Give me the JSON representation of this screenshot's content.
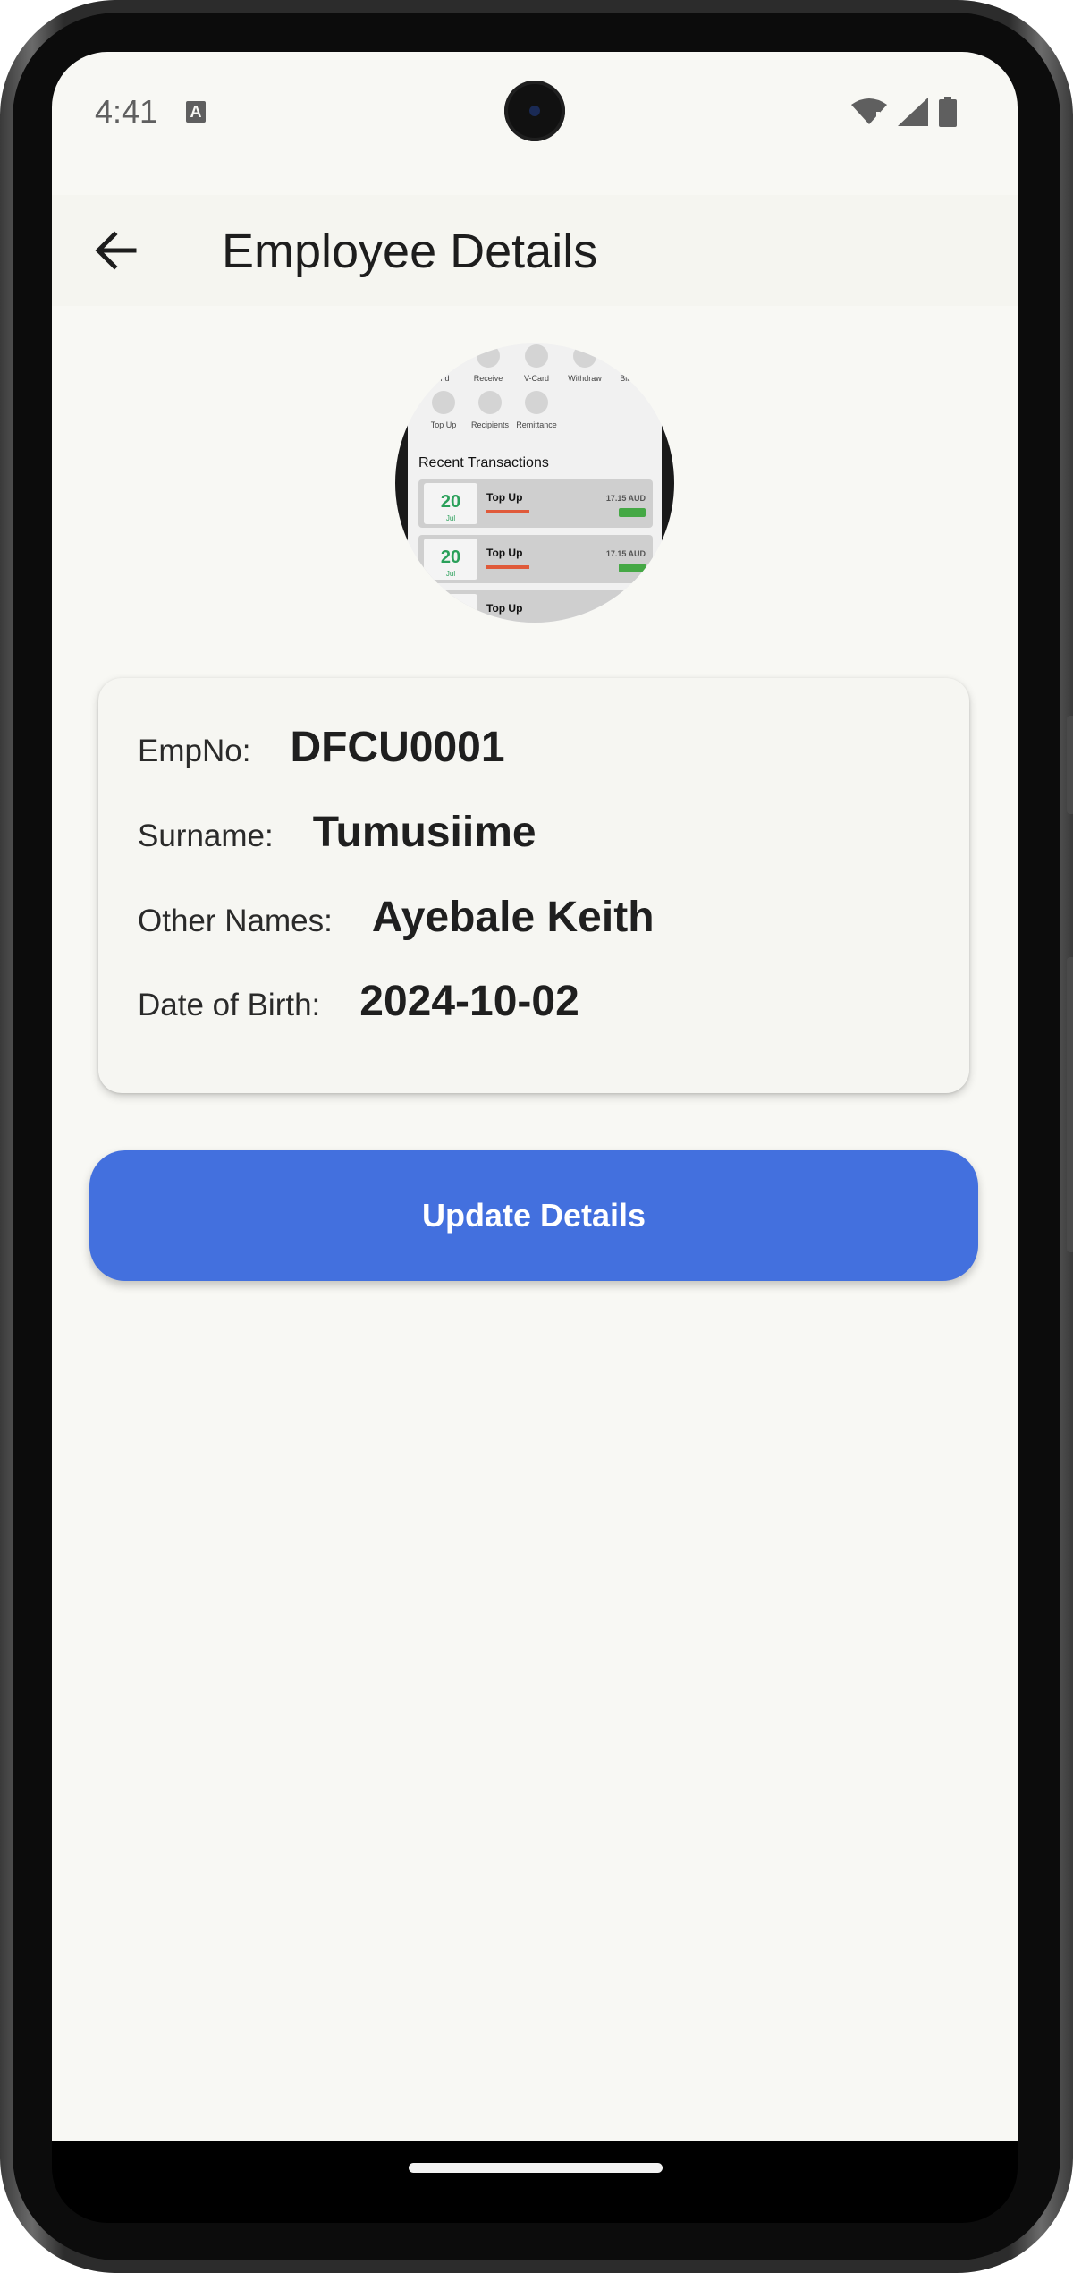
{
  "status_bar": {
    "time": "4:41",
    "notification_icon_label": "A",
    "icons": [
      "wifi-icon",
      "signal-icon",
      "battery-icon"
    ]
  },
  "app_bar": {
    "title": "Employee Details",
    "back_icon": "arrow-left-icon"
  },
  "avatar": {
    "quick_actions_row1": [
      "Send",
      "Receive",
      "V-Card",
      "Withdraw",
      "Bill Pa"
    ],
    "quick_actions_row2": [
      "Top Up",
      "Recipients",
      "Remittance"
    ],
    "section_title": "Recent Transactions",
    "transactions": [
      {
        "day": "20",
        "month": "Jul",
        "title": "Top Up",
        "amount": "17.15 AUD"
      },
      {
        "day": "20",
        "month": "Jul",
        "title": "Top Up",
        "amount": "17.15 AUD"
      },
      {
        "day": "",
        "month": "",
        "title": "Top Up",
        "amount": ""
      }
    ]
  },
  "details": {
    "emp_no_label": "EmpNo:",
    "emp_no": "DFCU0001",
    "surname_label": "Surname:",
    "surname": "Tumusiime",
    "other_names_label": "Other Names:",
    "other_names": "Ayebale Keith",
    "dob_label": "Date of Birth:",
    "dob": "2024-10-02"
  },
  "actions": {
    "update_label": "Update Details"
  },
  "colors": {
    "background": "#f8f8f4",
    "primary": "#4370de",
    "text": "#1f1f1f"
  }
}
